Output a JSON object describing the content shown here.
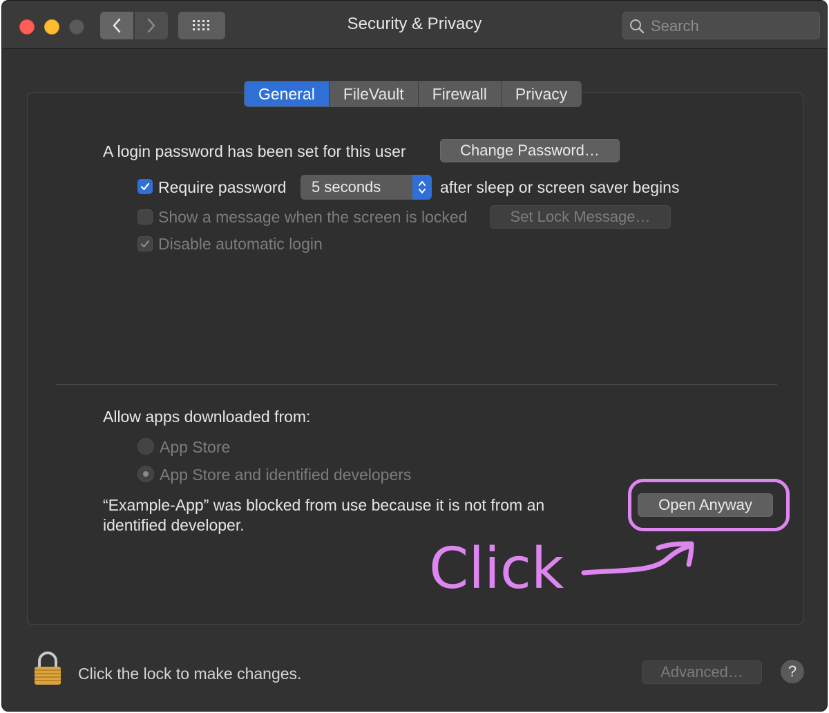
{
  "window": {
    "title": "Security & Privacy",
    "search_placeholder": "Search"
  },
  "tabs": [
    {
      "label": "General",
      "active": true
    },
    {
      "label": "FileVault",
      "active": false
    },
    {
      "label": "Firewall",
      "active": false
    },
    {
      "label": "Privacy",
      "active": false
    }
  ],
  "general": {
    "login_text": "A login password has been set for this user",
    "change_password_label": "Change Password…",
    "require_password": {
      "label": "Require password",
      "checked": true,
      "delay_value": "5 seconds",
      "suffix": "after sleep or screen saver begins"
    },
    "show_message": {
      "label": "Show a message when the screen is locked",
      "checked": false,
      "enabled": false,
      "button_label": "Set Lock Message…"
    },
    "disable_auto_login": {
      "label": "Disable automatic login",
      "checked": true,
      "enabled": false
    }
  },
  "allow_apps": {
    "heading": "Allow apps downloaded from:",
    "options": [
      {
        "label": "App Store",
        "selected": false
      },
      {
        "label": "App Store and identified developers",
        "selected": true
      }
    ],
    "blocked_message_line1": "“Example-App” was blocked from use because it is not from an",
    "blocked_message_line2": "identified developer.",
    "open_anyway_label": "Open Anyway"
  },
  "annotation": {
    "text": "Click",
    "color": "#de86f0"
  },
  "footer": {
    "lock_text": "Click the lock to make changes.",
    "advanced_label": "Advanced…",
    "help_label": "?"
  },
  "colors": {
    "accent": "#2f6fd6",
    "close": "#ff5f57",
    "minimize": "#febc2e"
  }
}
